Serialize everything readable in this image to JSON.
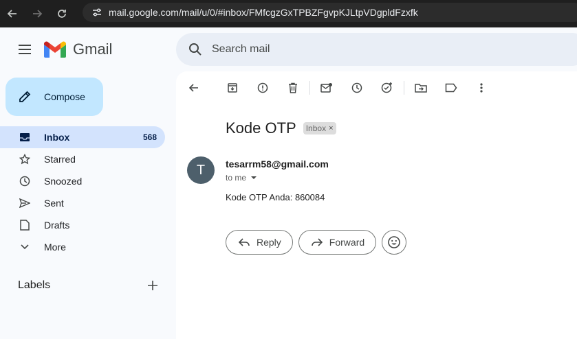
{
  "browser": {
    "url": "mail.google.com/mail/u/0/#inbox/FMfcgzGxTPBZFgvpKJLtpVDgpldFzxfk"
  },
  "app": {
    "name": "Gmail",
    "search_placeholder": "Search mail"
  },
  "sidebar": {
    "compose_label": "Compose",
    "items": [
      {
        "label": "Inbox",
        "count": "568",
        "icon": "inbox-icon",
        "active": true
      },
      {
        "label": "Starred",
        "count": "",
        "icon": "star-icon"
      },
      {
        "label": "Snoozed",
        "count": "",
        "icon": "clock-icon"
      },
      {
        "label": "Sent",
        "count": "",
        "icon": "send-icon"
      },
      {
        "label": "Drafts",
        "count": "",
        "icon": "draft-icon"
      },
      {
        "label": "More",
        "count": "",
        "icon": "chevron-down-icon"
      }
    ],
    "labels_title": "Labels"
  },
  "toolbar": {
    "icons": [
      "back-arrow-icon",
      "archive-icon",
      "report-spam-icon",
      "delete-icon",
      "mark-unread-icon",
      "snooze-icon",
      "add-to-tasks-icon",
      "move-to-icon",
      "label-icon",
      "more-vert-icon"
    ]
  },
  "message": {
    "subject": "Kode OTP",
    "label_badge": "Inbox",
    "badge_close": "×",
    "avatar_letter": "T",
    "sender": "tesarrm58@gmail.com",
    "to": "to me",
    "body": "Kode OTP Anda: 860084",
    "reply_label": "Reply",
    "forward_label": "Forward"
  },
  "colors": {
    "accent": "#c2e7ff",
    "active_nav": "#d3e3fd",
    "avatar": "#4d5f6b"
  }
}
